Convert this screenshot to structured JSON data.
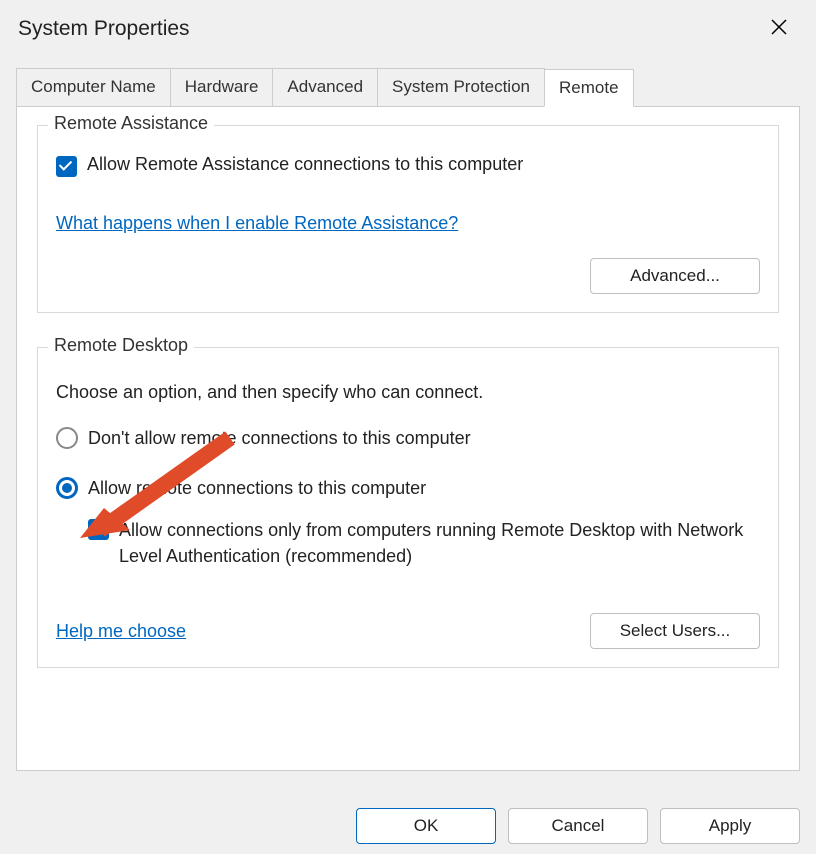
{
  "window": {
    "title": "System Properties"
  },
  "tabs": {
    "items": [
      {
        "label": "Computer Name"
      },
      {
        "label": "Hardware"
      },
      {
        "label": "Advanced"
      },
      {
        "label": "System Protection"
      },
      {
        "label": "Remote"
      }
    ],
    "active_index": 4
  },
  "remote_assistance": {
    "legend": "Remote Assistance",
    "checkbox_label": "Allow Remote Assistance connections to this computer",
    "checkbox_checked": true,
    "help_link": "What happens when I enable Remote Assistance?",
    "advanced_button": "Advanced..."
  },
  "remote_desktop": {
    "legend": "Remote Desktop",
    "instruction": "Choose an option, and then specify who can connect.",
    "radio_options": [
      {
        "label": "Don't allow remote connections to this computer",
        "selected": false
      },
      {
        "label": "Allow remote connections to this computer",
        "selected": true
      }
    ],
    "nla_checkbox_label": "Allow connections only from computers running Remote Desktop with Network Level Authentication (recommended)",
    "nla_checkbox_checked": true,
    "help_link": "Help me choose",
    "select_users_button": "Select Users..."
  },
  "dialog_buttons": {
    "ok": "OK",
    "cancel": "Cancel",
    "apply": "Apply"
  },
  "annotation": {
    "arrow_color": "#e04b2a"
  }
}
